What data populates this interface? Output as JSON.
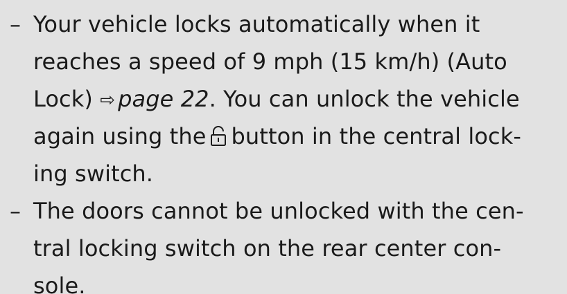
{
  "bullet_1": {
    "dash": "–",
    "line_1": "Your vehicle locks automatically when it",
    "line_2": "reaches a speed of 9 mph (15 km/h) (Auto",
    "line_3_prefix": "Lock)",
    "line_3_arrow": "⇨",
    "line_3_page_ref": "page 22",
    "line_3_suffix": ". You can unlock the vehicle",
    "line_4_prefix": "again using the",
    "line_4_icon": "unlock-icon",
    "line_4_suffix": "button in the central lock-",
    "line_5": "ing switch."
  },
  "bullet_2": {
    "dash": "–",
    "line_1": "The doors cannot be unlocked with the cen-",
    "line_2": "tral locking switch on the rear center con-",
    "line_3": "sole."
  }
}
